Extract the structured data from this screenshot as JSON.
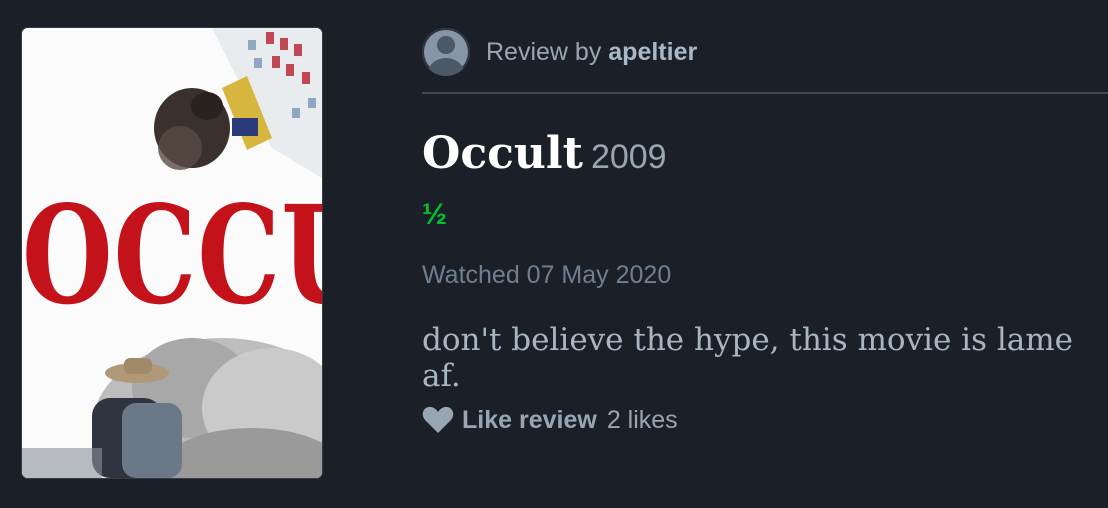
{
  "poster": {
    "title_text": "OCCULT",
    "title_color": "#c4121a"
  },
  "review": {
    "prefix": "Review by",
    "author": "apeltier",
    "film_title": "Occult",
    "film_year": "2009",
    "rating_text": "½",
    "watched": "Watched 07 May 2020",
    "body": "don't believe the hype, this movie is lame af."
  },
  "actions": {
    "icon": "heart-icon",
    "like_label": "Like review",
    "likes_count": "2 likes"
  },
  "colors": {
    "background": "#1b2028",
    "rating_green": "#00c030",
    "title_white": "#ffffff",
    "muted": "#98a6b4"
  }
}
